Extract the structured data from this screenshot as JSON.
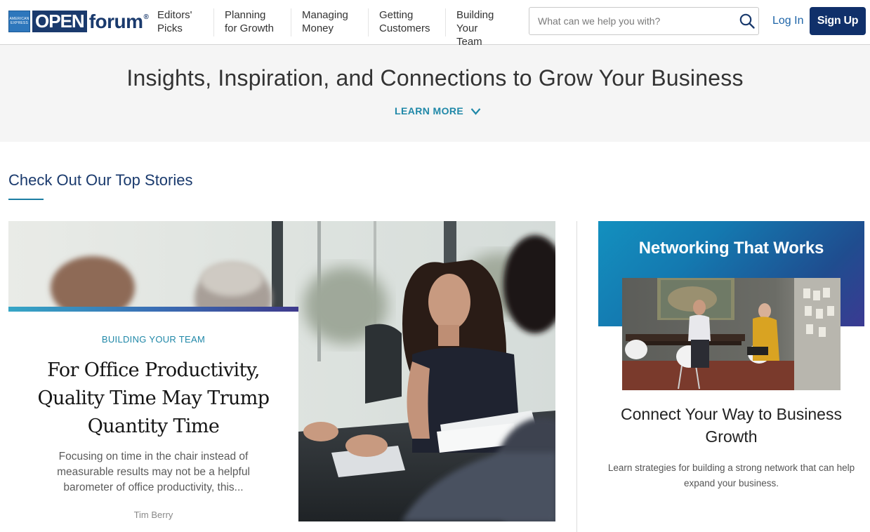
{
  "brand": {
    "amex_line1": "AMERICAN",
    "amex_line2": "EXPRESS",
    "open": "OPEN",
    "forum": "forum",
    "registered": "®",
    "colors": {
      "navy": "#10306a",
      "teal": "#2088a8",
      "link": "#1d64a8"
    }
  },
  "nav": {
    "items": [
      {
        "line1": "Editors'",
        "line2": "Picks"
      },
      {
        "line1": "Planning",
        "line2": "for Growth"
      },
      {
        "line1": "Managing",
        "line2": "Money"
      },
      {
        "line1": "Getting",
        "line2": "Customers"
      },
      {
        "line1": "Building",
        "line2": "Your Team"
      }
    ]
  },
  "search": {
    "placeholder": "What can we help you with?",
    "value": "",
    "icon": "search-icon"
  },
  "auth": {
    "login": "Log In",
    "signup": "Sign Up"
  },
  "hero": {
    "title": "Insights, Inspiration, and Connections to Grow Your Business",
    "learn_more": "LEARN MORE",
    "icon": "chevron-down-icon"
  },
  "section": {
    "title": "Check Out Our Top Stories"
  },
  "main_story": {
    "category": "BUILDING YOUR TEAM",
    "headline": "For Office Productivity, Quality Time May Trump Quantity Time",
    "excerpt": "Focusing on time in the chair instead of measurable results may not be a helpful barometer of office productivity, this...",
    "author": "Tim Berry"
  },
  "side_promo": {
    "banner": "Networking That Works",
    "headline": "Connect Your Way to Business Growth",
    "description": "Learn strategies for building a strong network that can help expand your business."
  }
}
